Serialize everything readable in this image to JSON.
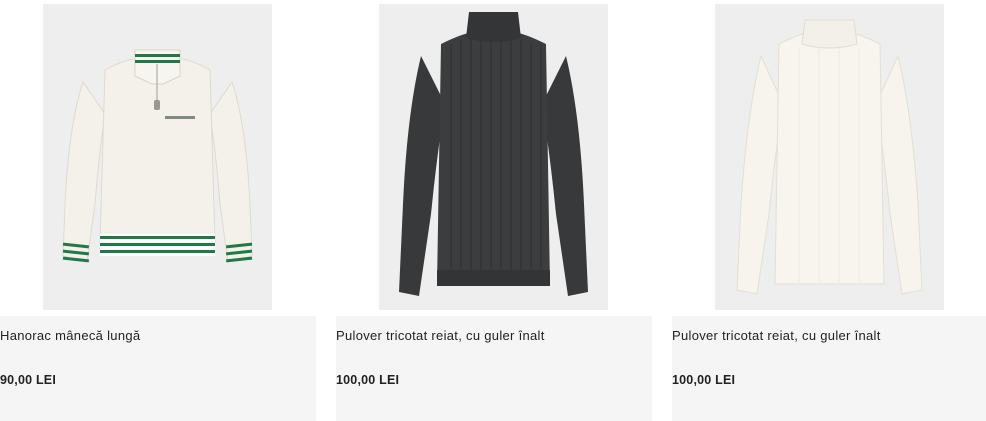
{
  "products": [
    {
      "title": "Hanorac mânecă lungă",
      "price": "90,00 LEI",
      "image_icon": "white-half-zip-sweatshirt-image",
      "colors": {
        "body": "#f3f1ea",
        "stripe": "#1f7a47",
        "trim": "#ffffff"
      }
    },
    {
      "title": "Pulover tricotat reiat, cu guler înalt",
      "price": "100,00 LEI",
      "image_icon": "charcoal-turtleneck-sweater-image",
      "colors": {
        "body": "#3a3b3c"
      }
    },
    {
      "title": "Pulover tricotat reiat, cu guler înalt",
      "price": "100,00 LEI",
      "image_icon": "cream-turtleneck-sweater-image",
      "colors": {
        "body": "#f6f4ec"
      }
    }
  ]
}
